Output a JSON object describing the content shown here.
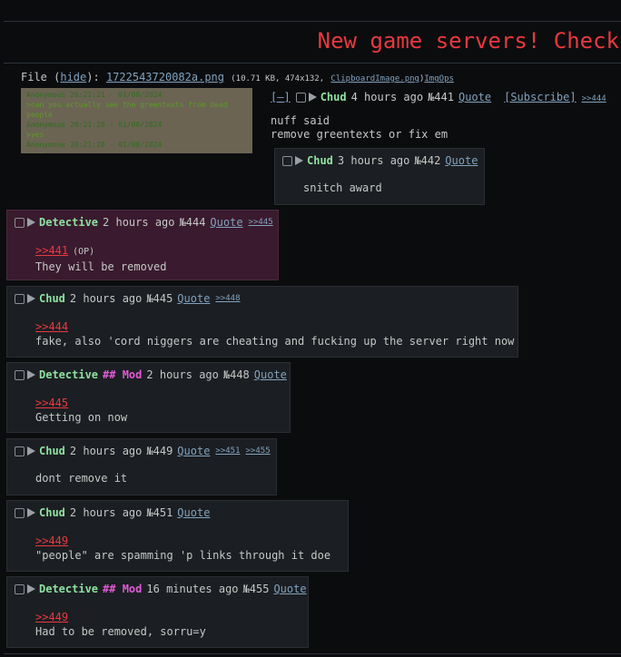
{
  "title": "New game servers! Check",
  "file": {
    "label": "File (",
    "hide": "hide",
    "after_hide": "):",
    "filename": "1722543720082a.png",
    "meta": "(10.71 KB, 474x132,",
    "origname": "ClipboardImage.png",
    "close": ")",
    "imgops": "ImgOps"
  },
  "thumb_lines": [
    {
      "text": "Anonymous 20:21:21 - 01/08/2024",
      "cls": "n"
    },
    {
      "text": ">can you actually see the greentexts from dead people",
      "cls": "g"
    },
    {
      "text": "Anonymous 20:21:28 - 01/08/2024",
      "cls": "n"
    },
    {
      "text": ">yes",
      "cls": "g"
    },
    {
      "text": "Anonymous 20:21:28 - 01/08/2024",
      "cls": "n"
    },
    {
      "text": ">yes",
      "cls": "g"
    }
  ],
  "op": {
    "toggle": "[–]",
    "name": "Chud",
    "time": "4 hours ago",
    "num": "№441",
    "quote": "Quote",
    "subscribe": "[Subscribe]",
    "backlinks": [
      ">>444"
    ],
    "body": [
      "nuff said",
      "remove greentexts or fix em"
    ]
  },
  "posts": [
    {
      "name": "Chud",
      "mod": "",
      "time": "3 hours ago",
      "num": "№442",
      "quote": "Quote",
      "backlinks": [],
      "ref": "",
      "ref_op": "",
      "body": "snitch award"
    },
    {
      "name": "Detective",
      "mod": "",
      "time": "2 hours ago",
      "num": "№444",
      "quote": "Quote",
      "backlinks": [
        ">>445"
      ],
      "ref": ">>441",
      "ref_op": "(OP)",
      "body": "They will be removed"
    },
    {
      "name": "Chud",
      "mod": "",
      "time": "2 hours ago",
      "num": "№445",
      "quote": "Quote",
      "backlinks": [
        ">>448"
      ],
      "ref": ">>444",
      "ref_op": "",
      "body": "fake, also 'cord niggers are cheating and fucking up the server right now"
    },
    {
      "name": "Detective",
      "mod": "## Mod",
      "time": "2 hours ago",
      "num": "№448",
      "quote": "Quote",
      "backlinks": [],
      "ref": ">>445",
      "ref_op": "",
      "body": "Getting on now"
    },
    {
      "name": "Chud",
      "mod": "",
      "time": "2 hours ago",
      "num": "№449",
      "quote": "Quote",
      "backlinks": [
        ">>451",
        ">>455"
      ],
      "ref": "",
      "ref_op": "",
      "body": "dont remove it"
    },
    {
      "name": "Chud",
      "mod": "",
      "time": "2 hours ago",
      "num": "№451",
      "quote": "Quote",
      "backlinks": [],
      "ref": ">>449",
      "ref_op": "",
      "body": "\"people\" are spamming 'p links through it doe"
    },
    {
      "name": "Detective",
      "mod": "## Mod",
      "time": "16 minutes ago",
      "num": "№455",
      "quote": "Quote",
      "backlinks": [],
      "ref": ">>449",
      "ref_op": "",
      "body": "Had to be removed, sorru=y"
    }
  ]
}
